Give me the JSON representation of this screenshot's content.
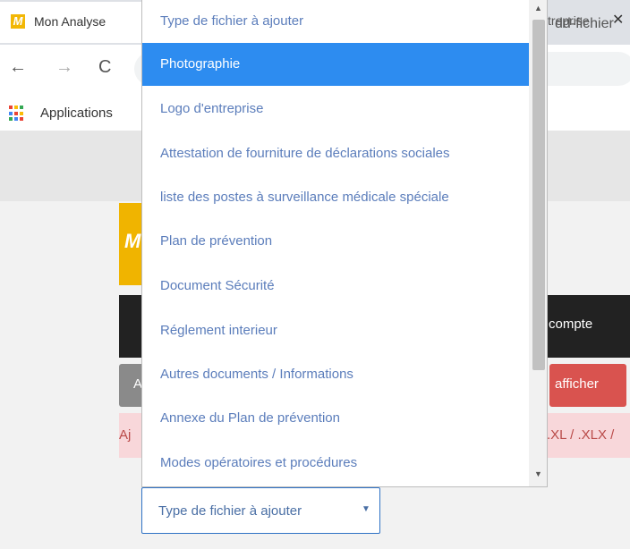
{
  "browser": {
    "tab_title": "Mon Analyse",
    "favicon_letter": "M",
    "tab2_title": "treprise",
    "tab2_close": "✕",
    "back": "←",
    "forward": "→",
    "reload": "C",
    "address_text": "dd-fichier",
    "bookmarks": {
      "apps_label": "Applications"
    }
  },
  "page": {
    "logo_letter": "M",
    "dark_bar_text": "compte",
    "gray_button_label": "A",
    "red_button_label": "afficher",
    "alert_left": "Aj",
    "alert_right": ".XL / .XLX /"
  },
  "select": {
    "label": "Type de fichier à ajouter",
    "caret": "▼"
  },
  "dropdown": {
    "options": [
      "Type de fichier à ajouter",
      "Photographie",
      "Logo d'entreprise",
      "Attestation de fourniture de déclarations sociales",
      "liste des postes à surveillance médicale spéciale",
      "Plan de prévention",
      "Document Sécurité",
      "Réglement interieur",
      "Autres documents / Informations",
      "Annexe du Plan de prévention",
      "Modes opératoires et procédures"
    ],
    "selected_index": 1,
    "scroll_up": "▲",
    "scroll_down": "▼"
  },
  "colors": {
    "selected_option": "#2d8cf0",
    "option_text": "#5b7dbb",
    "logo_yellow": "#f0b400",
    "alert_red": "#d9534f"
  }
}
